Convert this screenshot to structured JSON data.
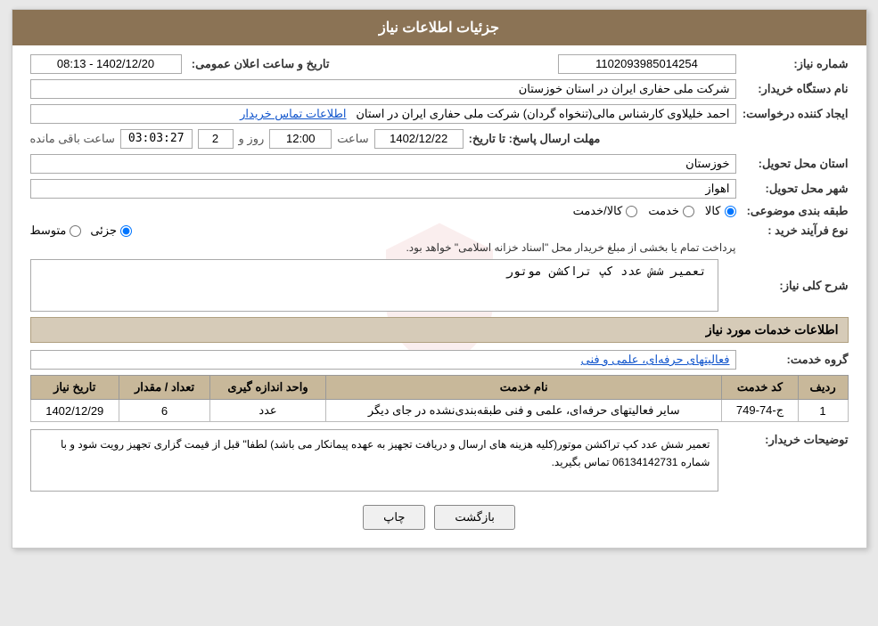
{
  "page": {
    "title": "جزئیات اطلاعات نیاز"
  },
  "fields": {
    "need_number_label": "شماره نیاز:",
    "need_number_value": "1102093985014254",
    "announcement_label": "تاریخ و ساعت اعلان عمومی:",
    "announcement_value": "1402/12/20 - 08:13",
    "buyer_org_label": "نام دستگاه خریدار:",
    "buyer_org_value": "شرکت ملی حفاری ایران در استان خوزستان",
    "creator_label": "ایجاد کننده درخواست:",
    "creator_value": "احمد خلیلاوی کارشناس مالی(تنخواه گردان) شرکت ملی حفاری ایران در استان",
    "creator_link": "اطلاعات تماس خریدار",
    "response_deadline_label": "مهلت ارسال پاسخ: تا تاریخ:",
    "response_date": "1402/12/22",
    "response_time_label": "ساعت",
    "response_time": "12:00",
    "response_days_label": "روز و",
    "response_days": "2",
    "response_timer": "03:03:27",
    "response_remaining": "ساعت باقی مانده",
    "province_label": "استان محل تحویل:",
    "province_value": "خوزستان",
    "city_label": "شهر محل تحویل:",
    "city_value": "اهواز",
    "category_label": "طبقه بندی موضوعی:",
    "category_options": [
      "کالا",
      "خدمت",
      "کالا/خدمت"
    ],
    "category_selected": "کالا",
    "process_label": "نوع فرآیند خرید :",
    "process_options": [
      "جزئی",
      "متوسط"
    ],
    "process_note": "پرداخت تمام یا بخشی از مبلغ خریدار محل \"اسناد خزانه اسلامی\" خواهد بود.",
    "need_summary_label": "شرح کلی نیاز:",
    "need_summary_value": "تعمیر شش عدد کپ تراکشن موتور",
    "services_section_label": "اطلاعات خدمات مورد نیاز",
    "service_group_label": "گروه خدمت:",
    "service_group_value": "فعالیتهای حرفه‌ای، علمی و فنی",
    "table": {
      "headers": [
        "ردیف",
        "کد خدمت",
        "نام خدمت",
        "واحد اندازه گیری",
        "تعداد / مقدار",
        "تاریخ نیاز"
      ],
      "rows": [
        {
          "row_num": "1",
          "service_code": "ج-74-749",
          "service_name": "سایر فعالیتهای حرفه‌ای، علمی و فنی طبقه‌بندی‌نشده در جای دیگر",
          "unit": "عدد",
          "quantity": "6",
          "date": "1402/12/29"
        }
      ]
    },
    "buyer_notes_label": "توضیحات خریدار:",
    "buyer_notes_value": "تعمیر شش عدد کپ تراکشن موتور(کلیه هزینه های ارسال و دریافت تجهیز به عهده پیمانکار می باشد) لطفا\" قبل از قیمت گزاری تجهیز رویت شود و با شماره 06134142731 تماس بگیرید.",
    "btn_print": "چاپ",
    "btn_back": "بازگشت"
  }
}
